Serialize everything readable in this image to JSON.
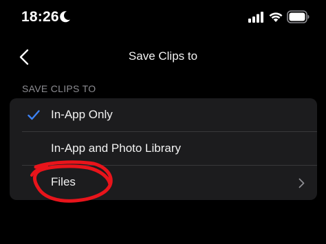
{
  "status_bar": {
    "time": "18:26",
    "icons": [
      "moon-icon",
      "cellular-signal-icon",
      "wifi-icon",
      "battery-icon"
    ]
  },
  "nav": {
    "back_icon": "chevron-left-icon",
    "title": "Save Clips to"
  },
  "section": {
    "header": "SAVE CLIPS TO",
    "options": [
      {
        "label": "In-App Only",
        "selected": true,
        "icon": "checkmark-icon"
      },
      {
        "label": "In-App and Photo Library",
        "selected": false
      },
      {
        "label": "Files",
        "selected": false,
        "icon": "chevron-right-icon"
      }
    ]
  },
  "colors": {
    "background": "#000000",
    "group_background": "#1c1c1e",
    "divider": "#38383a",
    "accent": "#3c82f6",
    "secondary_text": "#8d8d92",
    "annotation": "#e8141b"
  }
}
